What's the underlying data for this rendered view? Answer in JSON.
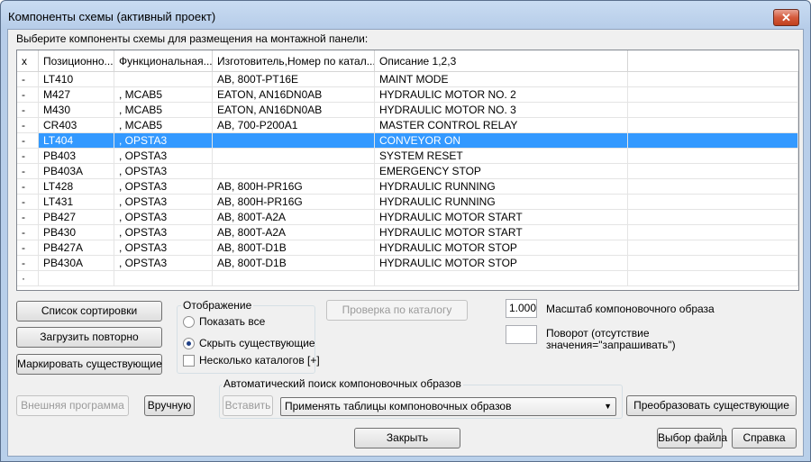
{
  "window": {
    "title": "Компоненты схемы (активный проект)",
    "close_glyph": "✕"
  },
  "instruction": "Выберите компоненты схемы для размещения на монтажной панели:",
  "table": {
    "columns": [
      "x",
      "Позиционно...",
      "Функциональная...",
      "Изготовитель,Номер по катал...",
      "Описание 1,2,3",
      ""
    ],
    "rows": [
      {
        "x": "-",
        "pos": "LT410",
        "func": "",
        "mfr": "AB, 800T-PT16E",
        "desc": "MAINT MODE"
      },
      {
        "x": "-",
        "pos": "M427",
        "func": ", MCAB5",
        "mfr": "EATON, AN16DN0AB",
        "desc": "HYDRAULIC MOTOR NO. 2"
      },
      {
        "x": "-",
        "pos": "M430",
        "func": ", MCAB5",
        "mfr": "EATON, AN16DN0AB",
        "desc": "HYDRAULIC MOTOR NO. 3"
      },
      {
        "x": "-",
        "pos": "CR403",
        "func": ", MCAB5",
        "mfr": "AB, 700-P200A1",
        "desc": "MASTER CONTROL RELAY"
      },
      {
        "x": "-",
        "pos": "LT404",
        "func": ", OPSTA3",
        "mfr": "",
        "desc": "CONVEYOR ON",
        "selected": true
      },
      {
        "x": "-",
        "pos": "PB403",
        "func": ", OPSTA3",
        "mfr": "",
        "desc": "SYSTEM RESET"
      },
      {
        "x": "-",
        "pos": "PB403A",
        "func": ", OPSTA3",
        "mfr": "",
        "desc": "EMERGENCY STOP"
      },
      {
        "x": "-",
        "pos": "LT428",
        "func": ", OPSTA3",
        "mfr": "AB, 800H-PR16G",
        "desc": "HYDRAULIC RUNNING"
      },
      {
        "x": "-",
        "pos": "LT431",
        "func": ", OPSTA3",
        "mfr": "AB, 800H-PR16G",
        "desc": "HYDRAULIC RUNNING"
      },
      {
        "x": "-",
        "pos": "PB427",
        "func": ", OPSTA3",
        "mfr": "AB, 800T-A2A",
        "desc": "HYDRAULIC MOTOR START"
      },
      {
        "x": "-",
        "pos": "PB430",
        "func": ", OPSTA3",
        "mfr": "AB, 800T-A2A",
        "desc": "HYDRAULIC MOTOR START"
      },
      {
        "x": "-",
        "pos": "PB427A",
        "func": ", OPSTA3",
        "mfr": "AB, 800T-D1B",
        "desc": "HYDRAULIC MOTOR STOP"
      },
      {
        "x": "-",
        "pos": "PB430A",
        "func": ", OPSTA3",
        "mfr": "AB, 800T-D1B",
        "desc": "HYDRAULIC MOTOR STOP"
      },
      {
        "x": "·",
        "pos": "",
        "func": "",
        "mfr": "",
        "desc": ""
      }
    ]
  },
  "buttons": {
    "sort_list": "Список сортировки",
    "reload": "Загрузить повторно",
    "mark_existing": "Маркировать существующие",
    "catalog_check": "Проверка по каталогу",
    "external_program": "Внешняя программа",
    "manual": "Вручную",
    "insert": "Вставить",
    "convert_existing": "Преобразовать существующие",
    "close": "Закрыть",
    "select_file": "Выбор файла",
    "help": "Справка"
  },
  "display_group": {
    "title": "Отображение",
    "show_all": "Показать все",
    "hide_existing": "Скрыть существующие",
    "several_catalogs": "Несколько каталогов [+]",
    "selected": "hide_existing"
  },
  "scale": {
    "value": "1.000",
    "label": "Масштаб компоновочного образа"
  },
  "rotation": {
    "value": "",
    "label_line1": "Поворот (отсутствие",
    "label_line2": "значения=\"запрашивать\")"
  },
  "auto_search": {
    "title": "Автоматический поиск компоновочных образов",
    "selected_option": "Применять таблицы компоновочных образов"
  }
}
